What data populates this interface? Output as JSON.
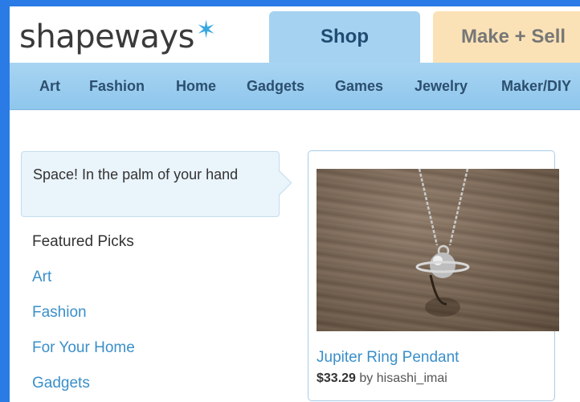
{
  "header": {
    "logo_text": "shapeways",
    "logo_star": "✶",
    "tabs": [
      {
        "label": "Shop"
      },
      {
        "label": "Make + Sell"
      }
    ]
  },
  "nav": {
    "items": [
      {
        "label": "Art"
      },
      {
        "label": "Fashion"
      },
      {
        "label": "Home"
      },
      {
        "label": "Gadgets"
      },
      {
        "label": "Games"
      },
      {
        "label": "Jewelry"
      },
      {
        "label": "Maker/DIY"
      }
    ]
  },
  "sidebar": {
    "callout": "Space! In the palm of your hand",
    "heading": "Featured Picks",
    "links": [
      {
        "label": "Art"
      },
      {
        "label": "Fashion"
      },
      {
        "label": "For Your Home"
      },
      {
        "label": "Gadgets"
      }
    ]
  },
  "product": {
    "title": "Jupiter Ring Pendant",
    "price": "$33.29",
    "by_text": "by hisashi_imai"
  },
  "colors": {
    "page_background": "#2a7be6",
    "shop_tab": "#a5d2f0",
    "make_tab": "#fbe2b6",
    "nav_bar": "#8ec6ec",
    "link": "#3a8fc9"
  }
}
